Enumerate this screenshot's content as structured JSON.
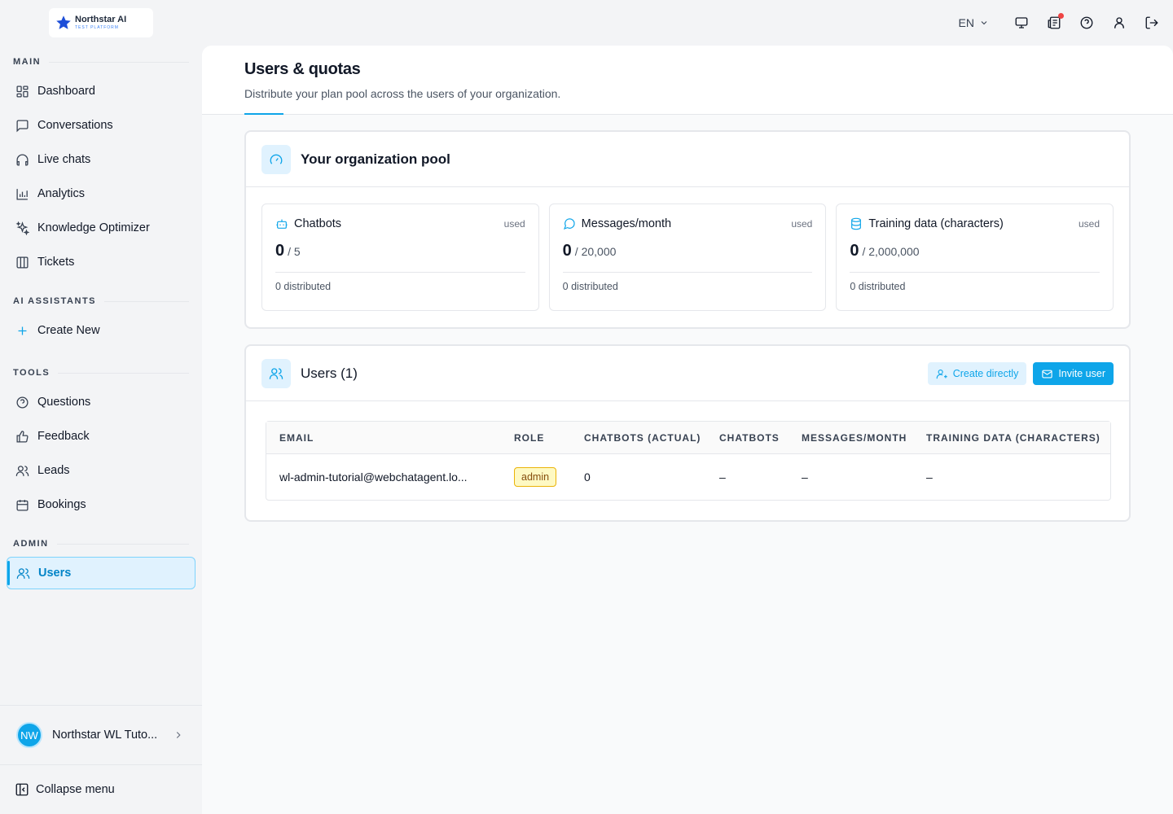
{
  "brand": {
    "name": "Northstar AI",
    "tagline": "TEST PLATFORM"
  },
  "sidebar": {
    "sections": {
      "main": "MAIN",
      "ai": "AI ASSISTANTS",
      "tools": "TOOLS",
      "admin": "ADMIN"
    },
    "items": {
      "dashboard": "Dashboard",
      "conversations": "Conversations",
      "live_chats": "Live chats",
      "analytics": "Analytics",
      "knowledge": "Knowledge Optimizer",
      "tickets": "Tickets",
      "create_new": "Create New",
      "questions": "Questions",
      "feedback": "Feedback",
      "leads": "Leads",
      "bookings": "Bookings",
      "users": "Users"
    },
    "account": {
      "initials": "NW",
      "name": "Northstar WL Tuto..."
    },
    "collapse": "Collapse menu"
  },
  "topbar": {
    "language": "EN"
  },
  "page": {
    "title": "Users & quotas",
    "subtitle": "Distribute your plan pool across the users of your organization."
  },
  "pool": {
    "title": "Your organization pool",
    "stats": [
      {
        "label": "Chatbots",
        "used_label": "used",
        "value": "0",
        "total": "/ 5",
        "distributed": "0 distributed"
      },
      {
        "label": "Messages/month",
        "used_label": "used",
        "value": "0",
        "total": "/ 20,000",
        "distributed": "0 distributed"
      },
      {
        "label": "Training data (characters)",
        "used_label": "used",
        "value": "0",
        "total": "/ 2,000,000",
        "distributed": "0 distributed"
      }
    ]
  },
  "users": {
    "title": "Users (1)",
    "create_label": "Create directly",
    "invite_label": "Invite user",
    "columns": [
      "EMAIL",
      "ROLE",
      "CHATBOTS (ACTUAL)",
      "CHATBOTS",
      "MESSAGES/MONTH",
      "TRAINING DATA (CHARACTERS)"
    ],
    "rows": [
      {
        "email": "wl-admin-tutorial@webchatagent.lo...",
        "role": "admin",
        "chatbots_actual": "0",
        "chatbots": "–",
        "messages": "–",
        "training": "–"
      }
    ]
  },
  "colors": {
    "accent": "#0ea5e9",
    "accent_light": "#e0f2fe",
    "badge_border": "#eab308",
    "notif": "#ef4444"
  }
}
